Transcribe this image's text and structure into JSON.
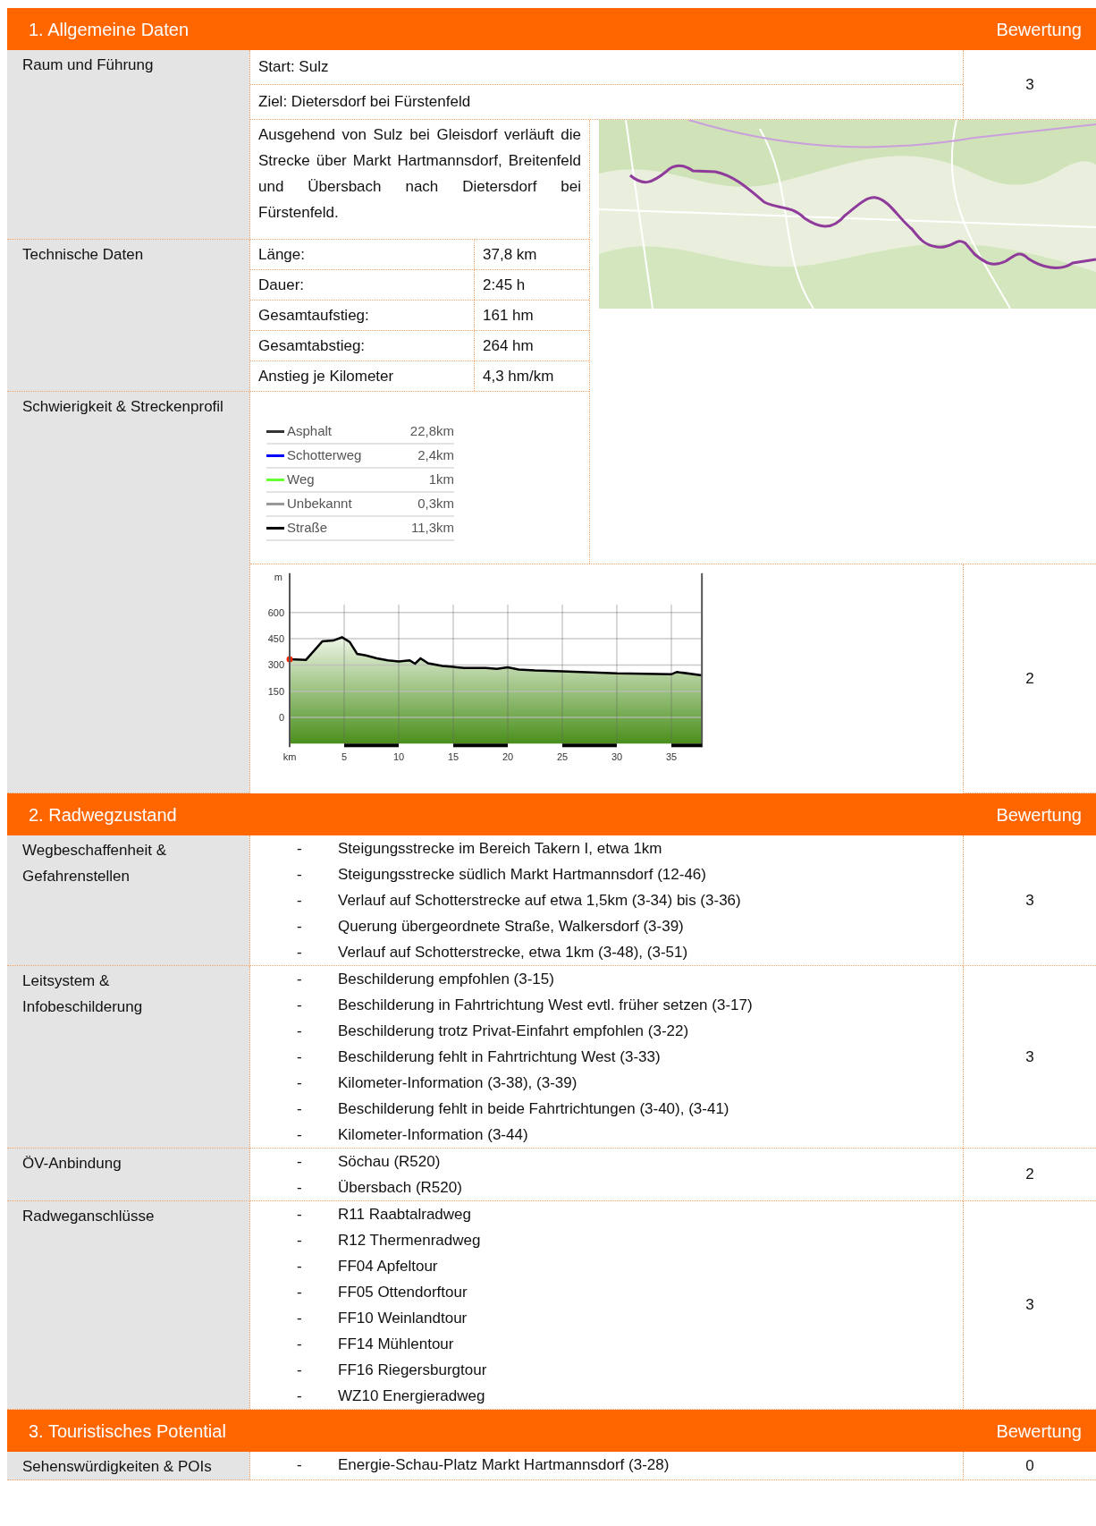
{
  "general": {
    "title": "1. Allgemeine Daten",
    "rating_header": "Bewertung",
    "route": {
      "label": "Raum und Führung",
      "start": "Start: Sulz",
      "goal": "Ziel: Dietersdorf bei Fürstenfeld",
      "rating": "3",
      "description": "Ausgehend von Sulz bei Gleisdorf verläuft die Strecke über Markt Hartmannsdorf, Breitenfeld und Übersbach nach Dietersdorf bei Fürstenfeld."
    },
    "technical": {
      "label": "Technische Daten",
      "rows": [
        {
          "name": "Länge:",
          "value": "37,8 km"
        },
        {
          "name": "Dauer:",
          "value": "2:45 h"
        },
        {
          "name": "Gesamtaufstieg:",
          "value": "161 hm"
        },
        {
          "name": "Gesamtabstieg:",
          "value": "264 hm"
        },
        {
          "name": "Anstieg je Kilometer",
          "value": "4,3 hm/km"
        }
      ]
    },
    "difficulty": {
      "label": "Schwierigkeit & Streckenprofil",
      "rating": "2",
      "legend": [
        {
          "name": "Asphalt",
          "value": "22,8km",
          "color": "#333333"
        },
        {
          "name": "Schotterweg",
          "value": "2,4km",
          "color": "#0000ff"
        },
        {
          "name": "Weg",
          "value": "1km",
          "color": "#66ff33"
        },
        {
          "name": "Unbekannt",
          "value": "0,3km",
          "color": "#999999"
        },
        {
          "name": "Straße",
          "value": "11,3km",
          "color": "#000000"
        }
      ],
      "chart_data": {
        "type": "area",
        "xlabel": "km",
        "ylabel": "m",
        "x": [
          0,
          1.5,
          3,
          4,
          4.8,
          5.5,
          6.2,
          7,
          8,
          9,
          10,
          11,
          11.5,
          12,
          12.7,
          14,
          16,
          18,
          19,
          20,
          21,
          22.5,
          25,
          30,
          35,
          35.5,
          37.8
        ],
        "series": [
          {
            "color": "#000000",
            "values": [
              333,
              329,
              435,
              440,
              458,
              432,
              363,
              355,
              338,
              326,
              320,
              326,
              307,
              338,
              309,
              295,
              283,
              283,
              278,
              286,
              274,
              269,
              264,
              252,
              247,
              260,
              240
            ]
          }
        ],
        "xlim": [
          0,
          37.8
        ],
        "ylim": [
          -150,
          825
        ],
        "grid": true,
        "bands": [
          {
            "axis": "y",
            "from": -150,
            "to": 0
          }
        ],
        "xticks": [
          5,
          10,
          15,
          20,
          25,
          30,
          35
        ],
        "yticks": [
          0,
          150,
          300,
          450,
          600
        ]
      }
    }
  },
  "sections": [
    {
      "title": "2. Radwegzustand",
      "rating_header": "Bewertung",
      "rows": [
        {
          "label": "Wegbeschaffenheit & Gefahrenstellen",
          "rating": "3",
          "marker": "-",
          "items": [
            "Steigungsstrecke im Bereich Takern I, etwa 1km",
            "Steigungsstrecke südlich Markt Hartmannsdorf (12-46)",
            "Verlauf auf Schotterstrecke auf etwa 1,5km (3-34) bis (3-36)",
            "Querung übergeordnete Straße, Walkersdorf (3-39)",
            "Verlauf auf Schotterstrecke, etwa 1km (3-48), (3-51)"
          ]
        },
        {
          "label": "Leitsystem & Infobeschilderung",
          "rating": "3",
          "marker": "-",
          "items": [
            "Beschilderung empfohlen (3-15)",
            "Beschilderung in Fahrtrichtung West evtl. früher setzen (3-17)",
            "Beschilderung trotz Privat-Einfahrt empfohlen (3-22)",
            "Beschilderung fehlt in Fahrtrichtung West (3-33)",
            "Kilometer-Information (3-38), (3-39)",
            "Beschilderung fehlt in beide Fahrtrichtungen (3-40), (3-41)",
            "Kilometer-Information (3-44)"
          ]
        },
        {
          "label": "ÖV-Anbindung",
          "rating": "2",
          "marker": "-",
          "items": [
            "Söchau (R520)",
            "Übersbach (R520)"
          ]
        },
        {
          "label": "Radweganschlüsse",
          "rating": "3",
          "marker": "-",
          "items": [
            "R11 Raabtalradweg",
            "R12 Thermenradweg",
            "FF04 Apfeltour",
            "FF05 Ottendorftour",
            "FF10 Weinlandtour",
            "FF14 Mühlentour",
            "FF16 Riegersburgtour",
            "WZ10 Energieradweg"
          ]
        }
      ]
    },
    {
      "title": "3. Touristisches Potential",
      "rating_header": "Bewertung",
      "rows": [
        {
          "label": "Sehenswürdigkeiten & POIs",
          "rating": "0",
          "marker": "-",
          "items": [
            "Energie-Schau-Platz Markt Hartmannsdorf (3-28)"
          ]
        }
      ]
    }
  ]
}
